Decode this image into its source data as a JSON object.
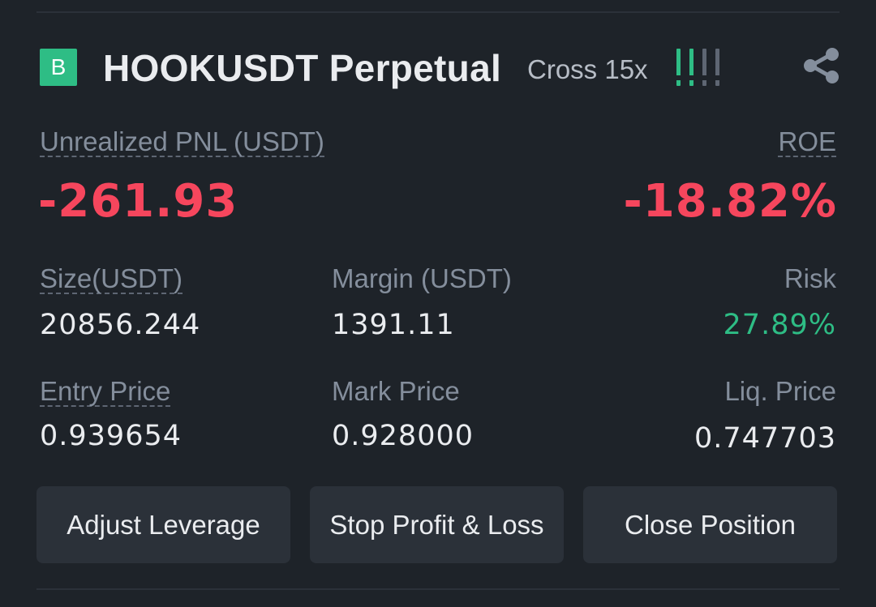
{
  "position": {
    "side_badge": "B",
    "symbol": "HOOKUSDT Perpetual",
    "margin_mode": "Cross 15x",
    "risk_bars": {
      "filled": 2,
      "total": 4,
      "active_color": "#2ebd85",
      "inactive_color": "#5e6673"
    },
    "share_icon": "share-icon"
  },
  "pnl": {
    "label": "Unrealized PNL (USDT)",
    "value": "-261.93",
    "roe_label": "ROE",
    "roe_value": "-18.82%"
  },
  "stats": {
    "size_label": "Size(USDT)",
    "size_value": "20856.244",
    "margin_label": "Margin (USDT)",
    "margin_value": "1391.11",
    "risk_label": "Risk",
    "risk_value": "27.89%",
    "entry_label": "Entry Price",
    "entry_value": "0.939654",
    "mark_label": "Mark Price",
    "mark_value": "0.928000",
    "liq_label": "Liq. Price",
    "liq_value": "0.747703"
  },
  "actions": {
    "adjust_leverage": "Adjust Leverage",
    "stop_profit_loss": "Stop Profit & Loss",
    "close_position": "Close Position"
  },
  "colors": {
    "background": "#1e2329",
    "negative": "#f6465d",
    "positive": "#2ebd85",
    "button_bg": "#2b3139"
  }
}
